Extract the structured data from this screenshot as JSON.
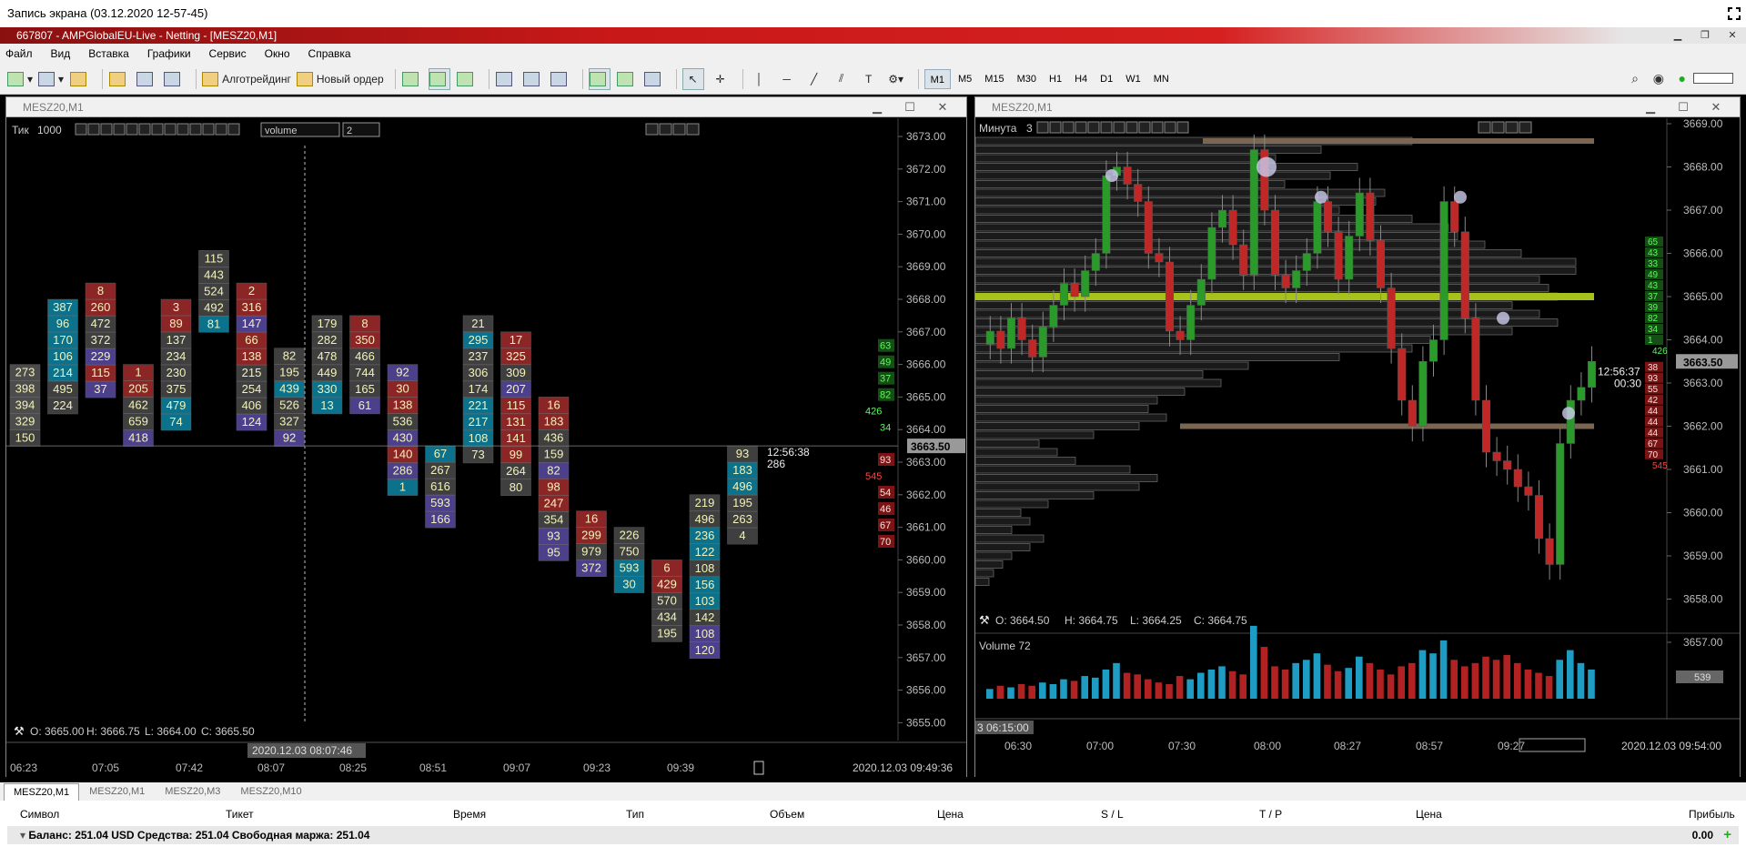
{
  "recording_title": "Запись экрана (03.12.2020 12-57-45)",
  "app_title": "667807 - AMPGlobalEU-Live - Netting - [MESZ20,M1]",
  "menu": [
    "Файл",
    "Вид",
    "Вставка",
    "Графики",
    "Сервис",
    "Окно",
    "Справка"
  ],
  "toolbar": {
    "algo": "Алготрейдинг",
    "new_order": "Новый ордер",
    "timeframes": [
      "M1",
      "M5",
      "M15",
      "M30",
      "H1",
      "H4",
      "D1",
      "W1",
      "MN"
    ],
    "selected_tf": "M1"
  },
  "left_window": {
    "title": "MESZ20,M1",
    "mode": "Тик",
    "mode_value": "1000",
    "combo": "volume",
    "spin": "2",
    "ohlc": {
      "o": "O: 3665.00",
      "h": "H: 3666.75",
      "l": "L: 3664.00",
      "c": "C: 3665.50"
    },
    "price_labels": [
      "3673.00",
      "3672.00",
      "3671.00",
      "3670.00",
      "3669.00",
      "3668.00",
      "3667.00",
      "3666.00",
      "3665.00",
      "3664.00",
      "3663.00",
      "3662.00",
      "3661.00",
      "3660.00",
      "3659.00",
      "3658.00",
      "3657.00",
      "3656.00",
      "3655.00"
    ],
    "current_price": "3663.50",
    "timer": "12:56:38",
    "timer_sub": "286",
    "time_labels": [
      "06:23",
      "07:05",
      "07:42",
      "08:07",
      "08:25",
      "08:51",
      "09:07",
      "09:23",
      "09:39"
    ],
    "cursor_time": "2020.12.03 08:07:46",
    "end_time": "2020.12.03 09:49:36",
    "dom_green": [
      "63",
      "49",
      "37",
      "82",
      "426",
      "34"
    ],
    "dom_red": [
      "93",
      "545",
      "54",
      "46",
      "67",
      "70"
    ],
    "footprint": [
      {
        "lvl": 3666,
        "cells": [
          {
            "v": "273",
            "c": "#666"
          },
          {
            "v": "398",
            "c": "#666"
          },
          {
            "v": "394",
            "c": "#666"
          },
          {
            "v": "329",
            "c": "#666"
          },
          {
            "v": "150",
            "c": "#555"
          }
        ]
      },
      {
        "lvl": 3668,
        "cells": [
          {
            "v": "387",
            "c": "#19b"
          },
          {
            "v": "96",
            "c": "#19b"
          },
          {
            "v": "170",
            "c": "#19b"
          },
          {
            "v": "106",
            "c": "#19b"
          },
          {
            "v": "214",
            "c": "#19b"
          },
          {
            "v": "495",
            "c": "#555"
          },
          {
            "v": "224",
            "c": "#555"
          }
        ]
      },
      {
        "lvl": 3668.5,
        "cells": [
          {
            "v": "8",
            "c": "#b33"
          },
          {
            "v": "260",
            "c": "#b33"
          },
          {
            "v": "472",
            "c": "#555"
          },
          {
            "v": "372",
            "c": "#555"
          },
          {
            "v": "229",
            "c": "#65b"
          },
          {
            "v": "115",
            "c": "#b33"
          },
          {
            "v": "37",
            "c": "#65b"
          }
        ]
      },
      {
        "lvl": 3666,
        "cells": [
          {
            "v": "1",
            "c": "#b33"
          },
          {
            "v": "205",
            "c": "#b33"
          },
          {
            "v": "462",
            "c": "#555"
          },
          {
            "v": "659",
            "c": "#555"
          },
          {
            "v": "418",
            "c": "#65b"
          }
        ]
      },
      {
        "lvl": 3668,
        "cells": [
          {
            "v": "3",
            "c": "#b33"
          },
          {
            "v": "89",
            "c": "#b33"
          },
          {
            "v": "137",
            "c": "#555"
          },
          {
            "v": "234",
            "c": "#555"
          },
          {
            "v": "230",
            "c": "#555"
          },
          {
            "v": "375",
            "c": "#555"
          },
          {
            "v": "479",
            "c": "#19b"
          },
          {
            "v": "74",
            "c": "#19b"
          }
        ]
      },
      {
        "lvl": 3669.5,
        "cells": [
          {
            "v": "115",
            "c": "#555"
          },
          {
            "v": "443",
            "c": "#555"
          },
          {
            "v": "524",
            "c": "#555"
          },
          {
            "v": "492",
            "c": "#555"
          },
          {
            "v": "81",
            "c": "#19b"
          }
        ]
      },
      {
        "lvl": 3668.5,
        "cells": [
          {
            "v": "2",
            "c": "#b33"
          },
          {
            "v": "316",
            "c": "#b33"
          },
          {
            "v": "147",
            "c": "#65b"
          },
          {
            "v": "66",
            "c": "#b33"
          },
          {
            "v": "138",
            "c": "#b33"
          },
          {
            "v": "215",
            "c": "#555"
          },
          {
            "v": "254",
            "c": "#555"
          },
          {
            "v": "406",
            "c": "#555"
          },
          {
            "v": "124",
            "c": "#65b"
          }
        ]
      },
      {
        "lvl": 3666.5,
        "cells": [
          {
            "v": "82",
            "c": "#555"
          },
          {
            "v": "195",
            "c": "#555"
          },
          {
            "v": "439",
            "c": "#19b"
          },
          {
            "v": "526",
            "c": "#555"
          },
          {
            "v": "327",
            "c": "#555"
          },
          {
            "v": "92",
            "c": "#65b"
          }
        ]
      },
      {
        "lvl": 3667.5,
        "cells": [
          {
            "v": "179",
            "c": "#555"
          },
          {
            "v": "282",
            "c": "#555"
          },
          {
            "v": "478",
            "c": "#555"
          },
          {
            "v": "449",
            "c": "#555"
          },
          {
            "v": "330",
            "c": "#19b"
          },
          {
            "v": "13",
            "c": "#19b"
          }
        ]
      },
      {
        "lvl": 3667.5,
        "cells": [
          {
            "v": "8",
            "c": "#b33"
          },
          {
            "v": "350",
            "c": "#b33"
          },
          {
            "v": "466",
            "c": "#555"
          },
          {
            "v": "744",
            "c": "#555"
          },
          {
            "v": "165",
            "c": "#555"
          },
          {
            "v": "61",
            "c": "#65b"
          }
        ]
      },
      {
        "lvl": 3666,
        "cells": [
          {
            "v": "92",
            "c": "#65b"
          },
          {
            "v": "30",
            "c": "#b33"
          },
          {
            "v": "138",
            "c": "#b33"
          },
          {
            "v": "536",
            "c": "#555"
          },
          {
            "v": "430",
            "c": "#65b"
          },
          {
            "v": "140",
            "c": "#b33"
          },
          {
            "v": "286",
            "c": "#65b"
          },
          {
            "v": "1",
            "c": "#19b"
          }
        ]
      },
      {
        "lvl": 3663.5,
        "cells": [
          {
            "v": "67",
            "c": "#19b"
          },
          {
            "v": "267",
            "c": "#555"
          },
          {
            "v": "616",
            "c": "#555"
          },
          {
            "v": "593",
            "c": "#65b"
          },
          {
            "v": "166",
            "c": "#65b"
          }
        ]
      },
      {
        "lvl": 3667.5,
        "cells": [
          {
            "v": "21",
            "c": "#555"
          },
          {
            "v": "295",
            "c": "#19b"
          },
          {
            "v": "237",
            "c": "#555"
          },
          {
            "v": "306",
            "c": "#555"
          },
          {
            "v": "174",
            "c": "#555"
          },
          {
            "v": "221",
            "c": "#19b"
          },
          {
            "v": "217",
            "c": "#19b"
          },
          {
            "v": "108",
            "c": "#19b"
          },
          {
            "v": "73",
            "c": "#555"
          }
        ]
      },
      {
        "lvl": 3667,
        "cells": [
          {
            "v": "17",
            "c": "#b33"
          },
          {
            "v": "325",
            "c": "#b33"
          },
          {
            "v": "309",
            "c": "#555"
          },
          {
            "v": "207",
            "c": "#65b"
          },
          {
            "v": "115",
            "c": "#b33"
          },
          {
            "v": "131",
            "c": "#b33"
          },
          {
            "v": "141",
            "c": "#b33"
          },
          {
            "v": "99",
            "c": "#b33"
          },
          {
            "v": "264",
            "c": "#555"
          },
          {
            "v": "80",
            "c": "#555"
          }
        ]
      },
      {
        "lvl": 3665,
        "cells": [
          {
            "v": "16",
            "c": "#b33"
          },
          {
            "v": "183",
            "c": "#b33"
          },
          {
            "v": "436",
            "c": "#555"
          },
          {
            "v": "159",
            "c": "#555"
          },
          {
            "v": "82",
            "c": "#65b"
          },
          {
            "v": "98",
            "c": "#b33"
          },
          {
            "v": "247",
            "c": "#b33"
          },
          {
            "v": "354",
            "c": "#555"
          },
          {
            "v": "93",
            "c": "#65b"
          },
          {
            "v": "95",
            "c": "#65b"
          }
        ]
      },
      {
        "lvl": 3661.5,
        "cells": [
          {
            "v": "16",
            "c": "#b33"
          },
          {
            "v": "299",
            "c": "#b33"
          },
          {
            "v": "979",
            "c": "#555"
          },
          {
            "v": "372",
            "c": "#65b"
          }
        ]
      },
      {
        "lvl": 3661,
        "cells": [
          {
            "v": "226",
            "c": "#555"
          },
          {
            "v": "750",
            "c": "#555"
          },
          {
            "v": "593",
            "c": "#19b"
          },
          {
            "v": "30",
            "c": "#19b"
          }
        ]
      },
      {
        "lvl": 3660,
        "cells": [
          {
            "v": "6",
            "c": "#b33"
          },
          {
            "v": "429",
            "c": "#b33"
          },
          {
            "v": "570",
            "c": "#555"
          },
          {
            "v": "434",
            "c": "#555"
          },
          {
            "v": "195",
            "c": "#555"
          }
        ]
      },
      {
        "lvl": 3662,
        "cells": [
          {
            "v": "219",
            "c": "#555"
          },
          {
            "v": "496",
            "c": "#555"
          },
          {
            "v": "236",
            "c": "#19b"
          },
          {
            "v": "122",
            "c": "#19b"
          },
          {
            "v": "108",
            "c": "#555"
          },
          {
            "v": "156",
            "c": "#19b"
          },
          {
            "v": "103",
            "c": "#19b"
          },
          {
            "v": "142",
            "c": "#555"
          },
          {
            "v": "108",
            "c": "#65b"
          },
          {
            "v": "120",
            "c": "#65b"
          }
        ]
      },
      {
        "lvl": 3663.5,
        "cells": [
          {
            "v": "93",
            "c": "#555"
          },
          {
            "v": "183",
            "c": "#19b"
          },
          {
            "v": "496",
            "c": "#19b"
          },
          {
            "v": "195",
            "c": "#555"
          },
          {
            "v": "263",
            "c": "#555"
          },
          {
            "v": "4",
            "c": "#555"
          }
        ]
      }
    ]
  },
  "right_window": {
    "title": "MESZ20,M1",
    "mode": "Минута",
    "mode_value": "3",
    "ohlc": {
      "o": "O: 3664.50",
      "h": "H: 3664.75",
      "l": "L: 3664.25",
      "c": "C: 3664.75"
    },
    "price_labels": [
      "3669.00",
      "3668.00",
      "3667.00",
      "3666.00",
      "3665.00",
      "3664.00",
      "3663.00",
      "3662.00",
      "3661.00",
      "3660.00",
      "3659.00",
      "3658.00",
      "3657.00"
    ],
    "current_price": "3663.50",
    "timer": "12:56:37",
    "timer_sub": "00:30",
    "volume_label": "Volume 72",
    "volume_value": "539",
    "start_time": "3 06:15:00",
    "time_labels": [
      "06:30",
      "07:00",
      "07:30",
      "08:00",
      "08:27",
      "08:57",
      "09:27"
    ],
    "end_time": "2020.12.03 09:54:00",
    "dom_green": [
      "65",
      "43",
      "33",
      "49",
      "43",
      "37",
      "39",
      "82",
      "34",
      "1",
      "426"
    ],
    "dom_red": [
      "38",
      "93",
      "55",
      "42",
      "44",
      "44",
      "44",
      "67",
      "70",
      "545"
    ],
    "candles": [
      3664.2,
      3663.8,
      3664.5,
      3664.0,
      3663.6,
      3664.3,
      3664.8,
      3665.3,
      3665.0,
      3665.6,
      3666.0,
      3667.8,
      3668.0,
      3667.6,
      3667.2,
      3666.0,
      3665.8,
      3664.2,
      3664.0,
      3664.8,
      3665.4,
      3666.6,
      3667.0,
      3666.2,
      3665.5,
      3668.4,
      3667.0,
      3665.5,
      3665.2,
      3665.6,
      3666.0,
      3667.2,
      3666.5,
      3665.4,
      3666.4,
      3667.4,
      3666.3,
      3665.2,
      3663.8,
      3662.6,
      3662.0,
      3663.5,
      3664.0,
      3667.2,
      3666.5,
      3664.5,
      3662.6,
      3661.4,
      3661.2,
      3661.0,
      3660.6,
      3660.4,
      3659.4,
      3658.8,
      3661.6,
      3662.6,
      3662.9,
      3663.5
    ],
    "volumes": [
      6,
      8,
      7,
      9,
      8,
      10,
      9,
      12,
      11,
      14,
      13,
      18,
      22,
      16,
      15,
      12,
      10,
      9,
      14,
      12,
      16,
      18,
      20,
      17,
      15,
      45,
      32,
      20,
      18,
      22,
      24,
      28,
      21,
      17,
      19,
      26,
      22,
      18,
      15,
      20,
      22,
      30,
      28,
      36,
      24,
      20,
      22,
      26,
      24,
      27,
      22,
      18,
      16,
      14,
      24,
      30,
      22,
      18
    ],
    "profile": [
      {
        "p": 3668.6,
        "w": 480
      },
      {
        "p": 3668.4,
        "w": 380
      },
      {
        "p": 3668.2,
        "w": 330
      },
      {
        "p": 3668.0,
        "w": 420
      },
      {
        "p": 3667.8,
        "w": 390
      },
      {
        "p": 3667.6,
        "w": 340
      },
      {
        "p": 3667.4,
        "w": 450
      },
      {
        "p": 3667.2,
        "w": 440
      },
      {
        "p": 3667.0,
        "w": 400
      },
      {
        "p": 3666.8,
        "w": 480
      },
      {
        "p": 3666.6,
        "w": 520
      },
      {
        "p": 3666.4,
        "w": 530
      },
      {
        "p": 3666.2,
        "w": 560
      },
      {
        "p": 3666.0,
        "w": 600
      },
      {
        "p": 3665.8,
        "w": 660
      },
      {
        "p": 3665.6,
        "w": 660
      },
      {
        "p": 3665.4,
        "w": 620
      },
      {
        "p": 3665.2,
        "w": 630
      },
      {
        "p": 3665.0,
        "w": 640
      },
      {
        "p": 3664.8,
        "w": 590
      },
      {
        "p": 3664.6,
        "w": 620
      },
      {
        "p": 3664.4,
        "w": 640
      },
      {
        "p": 3664.2,
        "w": 590
      },
      {
        "p": 3664.0,
        "w": 500
      },
      {
        "p": 3663.8,
        "w": 480
      },
      {
        "p": 3663.6,
        "w": 400
      },
      {
        "p": 3663.4,
        "w": 300
      },
      {
        "p": 3663.2,
        "w": 250
      },
      {
        "p": 3663.0,
        "w": 270
      },
      {
        "p": 3662.8,
        "w": 230
      },
      {
        "p": 3662.6,
        "w": 200
      },
      {
        "p": 3662.4,
        "w": 190
      },
      {
        "p": 3662.2,
        "w": 210
      },
      {
        "p": 3662.0,
        "w": 180
      },
      {
        "p": 3661.8,
        "w": 130
      },
      {
        "p": 3661.6,
        "w": 70
      },
      {
        "p": 3661.4,
        "w": 90
      },
      {
        "p": 3661.2,
        "w": 110
      },
      {
        "p": 3661.0,
        "w": 170
      },
      {
        "p": 3660.8,
        "w": 200
      },
      {
        "p": 3660.6,
        "w": 180
      },
      {
        "p": 3660.4,
        "w": 130
      },
      {
        "p": 3660.2,
        "w": 80
      },
      {
        "p": 3660.0,
        "w": 50
      },
      {
        "p": 3659.8,
        "w": 60
      },
      {
        "p": 3659.6,
        "w": 40
      },
      {
        "p": 3659.4,
        "w": 75
      },
      {
        "p": 3659.2,
        "w": 60
      },
      {
        "p": 3659.0,
        "w": 40
      },
      {
        "p": 3658.8,
        "w": 30
      },
      {
        "p": 3658.6,
        "w": 20
      },
      {
        "p": 3658.4,
        "w": 15
      }
    ]
  },
  "tabs": [
    "MESZ20,M1",
    "MESZ20,M1",
    "MESZ20,M3",
    "MESZ20,M10"
  ],
  "active_tab": 0,
  "terminal": {
    "columns": [
      "Символ",
      "Тикет",
      "Время",
      "Тип",
      "Объем",
      "Цена",
      "S / L",
      "T / P",
      "Цена",
      "Прибыль"
    ],
    "balance_line": "Баланс: 251.04 USD  Средства: 251.04  Свободная маржа: 251.04",
    "profit": "0.00"
  },
  "colors": {
    "up": "#2a9a2a",
    "down": "#c02828",
    "blue_cell": "#19b",
    "red_cell": "#b33",
    "purple_cell": "#65b",
    "poc": "#a6c21b"
  }
}
